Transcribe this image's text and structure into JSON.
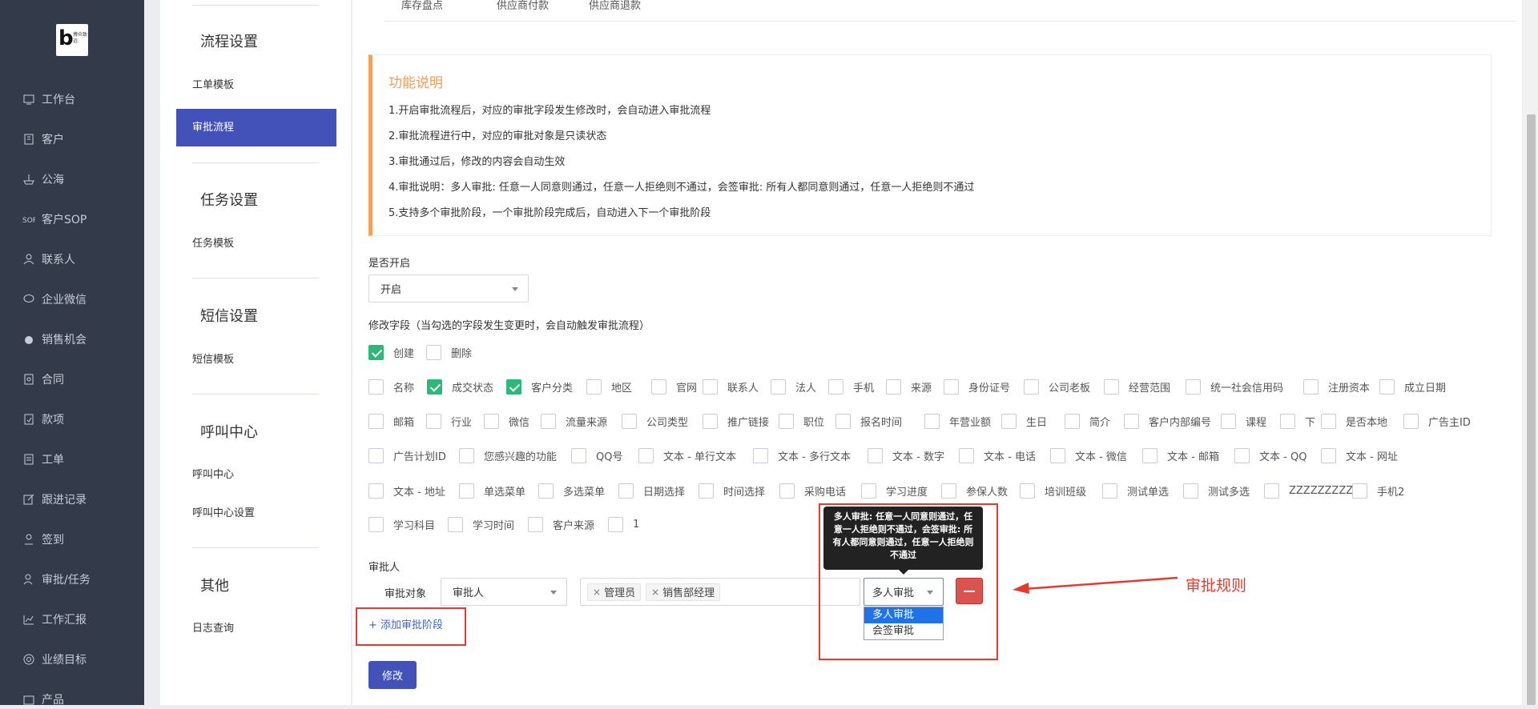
{
  "brand": {
    "logo_letter": "b",
    "logo_text": "博众致远"
  },
  "sidebar": {
    "items": [
      {
        "label": "工作台",
        "icon": "monitor-icon"
      },
      {
        "label": "客户",
        "icon": "building-icon"
      },
      {
        "label": "公海",
        "icon": "ship-icon"
      },
      {
        "label": "客户SOP",
        "icon": "sop-icon"
      },
      {
        "label": "联系人",
        "icon": "person-icon"
      },
      {
        "label": "企业微信",
        "icon": "chat-icon"
      },
      {
        "label": "销售机会",
        "icon": "money-bag-icon"
      },
      {
        "label": "合同",
        "icon": "contract-icon"
      },
      {
        "label": "款项",
        "icon": "payment-icon"
      },
      {
        "label": "工单",
        "icon": "document-icon"
      },
      {
        "label": "跟进记录",
        "icon": "edit-icon"
      },
      {
        "label": "签到",
        "icon": "location-person-icon"
      },
      {
        "label": "审批/任务",
        "icon": "approval-icon"
      },
      {
        "label": "工作汇报",
        "icon": "report-icon"
      },
      {
        "label": "业绩目标",
        "icon": "target-icon"
      },
      {
        "label": "产品",
        "icon": "box-icon"
      }
    ]
  },
  "settings_menu": {
    "sections": [
      {
        "title": "流程设置",
        "items": [
          {
            "label": "工单模板"
          },
          {
            "label": "审批流程"
          }
        ]
      },
      {
        "title": "任务设置",
        "items": [
          {
            "label": "任务模板"
          }
        ]
      },
      {
        "title": "短信设置",
        "items": [
          {
            "label": "短信模板"
          }
        ]
      },
      {
        "title": "呼叫中心",
        "items": [
          {
            "label": "呼叫中心"
          },
          {
            "label": "呼叫中心设置"
          }
        ]
      },
      {
        "title": "其他",
        "items": [
          {
            "label": "日志查询"
          }
        ]
      }
    ],
    "active": "审批流程"
  },
  "tabs": [
    "库存盘点",
    "供应商付款",
    "供应商退款"
  ],
  "notice": {
    "title": "功能说明",
    "lines": [
      "1.开启审批流程后，对应的审批字段发生修改时，会自动进入审批流程",
      "2.审批流程进行中，对应的审批对象是只读状态",
      "3.审批通过后，修改的内容会自动生效",
      "4.审批说明：多人审批: 任意一人同意则通过，任意一人拒绝则不通过，会签审批: 所有人都同意则通过，任意一人拒绝则不通过",
      "5.支持多个审批阶段，一个审批阶段完成后，自动进入下一个审批阶段"
    ]
  },
  "enable": {
    "label": "是否开启",
    "value": "开启"
  },
  "fields": {
    "label": "修改字段（当勾选的字段发生变更时，会自动触发审批流程）",
    "row0": [
      {
        "label": "创建",
        "checked": true
      },
      {
        "label": "删除",
        "checked": false
      }
    ],
    "row1": [
      {
        "label": "名称",
        "checked": false
      },
      {
        "label": "成交状态",
        "checked": true
      },
      {
        "label": "客户分类",
        "checked": true
      },
      {
        "label": "地区",
        "checked": false
      },
      {
        "label": "官网",
        "checked": false
      },
      {
        "label": "联系人",
        "checked": false
      },
      {
        "label": "法人",
        "checked": false
      },
      {
        "label": "手机",
        "checked": false
      },
      {
        "label": "来源",
        "checked": false
      },
      {
        "label": "身份证号",
        "checked": false
      },
      {
        "label": "公司老板",
        "checked": false
      },
      {
        "label": "经营范围",
        "checked": false
      },
      {
        "label": "统一社会信用码",
        "checked": false
      },
      {
        "label": "注册资本",
        "checked": false
      },
      {
        "label": "成立日期",
        "checked": false
      }
    ],
    "row2": [
      {
        "label": "邮箱"
      },
      {
        "label": "行业"
      },
      {
        "label": "微信"
      },
      {
        "label": "流量来源"
      },
      {
        "label": "公司类型"
      },
      {
        "label": "推广链接"
      },
      {
        "label": "职位"
      },
      {
        "label": "报名时间"
      },
      {
        "label": "年营业额"
      },
      {
        "label": "生日"
      },
      {
        "label": "简介"
      },
      {
        "label": "客户内部编号"
      },
      {
        "label": "课程"
      },
      {
        "label": "下"
      },
      {
        "label": "是否本地"
      },
      {
        "label": "广告主ID"
      }
    ],
    "row3": [
      {
        "label": "广告计划ID"
      },
      {
        "label": "您感兴趣的功能"
      },
      {
        "label": "QQ号"
      },
      {
        "label": "文本 - 单行文本"
      },
      {
        "label": "文本 - 多行文本"
      },
      {
        "label": "文本 - 数字"
      },
      {
        "label": "文本 - 电话"
      },
      {
        "label": "文本 - 微信"
      },
      {
        "label": "文本 - 邮箱"
      },
      {
        "label": "文本 - QQ"
      },
      {
        "label": "文本 - 网址"
      }
    ],
    "row4": [
      {
        "label": "文本 - 地址"
      },
      {
        "label": "单选菜单"
      },
      {
        "label": "多选菜单"
      },
      {
        "label": "日期选择"
      },
      {
        "label": "时间选择"
      },
      {
        "label": "采购电话"
      },
      {
        "label": "学习进度"
      },
      {
        "label": "参保人数"
      },
      {
        "label": "培训班级"
      },
      {
        "label": "测试单选"
      },
      {
        "label": "测试多选"
      },
      {
        "label": "ZZZZZZZZZ"
      },
      {
        "label": "手机2"
      }
    ],
    "row5": [
      {
        "label": "学习科目"
      },
      {
        "label": "学习时间"
      },
      {
        "label": "客户来源"
      },
      {
        "label": "1"
      }
    ]
  },
  "approver": {
    "section_label": "审批人",
    "object_label": "审批对象",
    "object_value": "审批人",
    "tags": [
      "管理员",
      "销售部经理"
    ],
    "rule_value": "多人审批",
    "rule_options": [
      "多人审批",
      "会签审批"
    ],
    "tooltip": "多人审批: 任意一人同意则通过，任意一人拒绝则不通过，会签审批: 所有人都同意则通过，任意一人拒绝则不通过"
  },
  "add_stage": "+ 添加审批阶段",
  "submit": "修改",
  "annotation": "审批规则",
  "colors": {
    "accent": "#4352b8",
    "notice": "#ee9d55",
    "check": "#2db77a",
    "danger": "#d9534f",
    "annotation": "#e53b2f"
  }
}
